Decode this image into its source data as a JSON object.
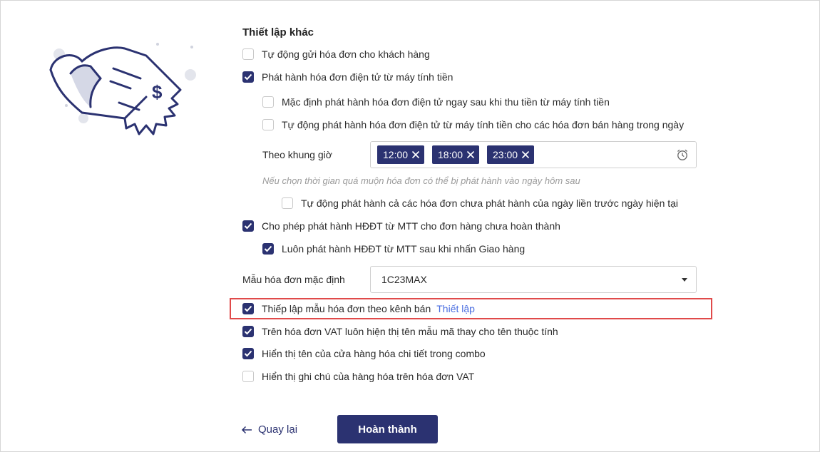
{
  "section_title": "Thiết lập khác",
  "options": {
    "auto_send": {
      "label": "Tự động gửi hóa đơn cho khách hàng",
      "checked": false
    },
    "issue_from_pos": {
      "label": "Phát hành hóa đơn điện tử từ máy tính tiền",
      "checked": true
    },
    "default_issue_after_payment": {
      "label": "Mặc định phát hành hóa đơn điện tử ngay sau khi thu tiền từ máy tính tiền",
      "checked": false
    },
    "auto_issue_daily": {
      "label": "Tự động phát hành hóa đơn điện tử từ máy tính tiền cho các hóa đơn bán hàng trong ngày",
      "checked": false
    },
    "auto_issue_previous_day": {
      "label": "Tự động phát hành cả các hóa đơn chưa phát hành của ngày liền trước ngày hiện tại",
      "checked": false
    },
    "allow_unfinished_orders": {
      "label": "Cho phép phát hành HĐĐT từ MTT cho đơn hàng chưa hoàn thành",
      "checked": true
    },
    "always_issue_on_delivery": {
      "label": "Luôn phát hành HĐĐT từ MTT sau khi nhấn Giao hàng",
      "checked": true
    },
    "template_by_channel": {
      "label": "Thiếp lập mẫu hóa đơn theo kênh bán",
      "checked": true,
      "link_label": "Thiết lập"
    },
    "show_sample_code": {
      "label": "Trên hóa đơn VAT luôn hiện thị tên mẫu mã thay cho tên thuộc tính",
      "checked": true
    },
    "show_combo_items": {
      "label": "Hiển thị tên của cửa hàng hóa chi tiết trong combo",
      "checked": true
    },
    "show_item_notes": {
      "label": "Hiển thị ghi chú của hàng hóa trên hóa đơn VAT",
      "checked": false
    }
  },
  "time_slots": {
    "label": "Theo khung giờ",
    "chips": [
      "12:00",
      "18:00",
      "23:00"
    ],
    "icon": "alarm-clock-icon"
  },
  "hint": "Nếu chọn thời gian quá muộn hóa đơn có thể bị phát hành vào ngày hôm sau",
  "default_template": {
    "label": "Mẫu hóa đơn mặc định",
    "value": "1C23MAX"
  },
  "footer": {
    "back_label": "Quay lại",
    "finish_label": "Hoàn thành"
  },
  "colors": {
    "primary": "#2b3271",
    "link": "#4a6ee0",
    "highlight": "#e04a4a",
    "hint": "#9a9a9a"
  }
}
